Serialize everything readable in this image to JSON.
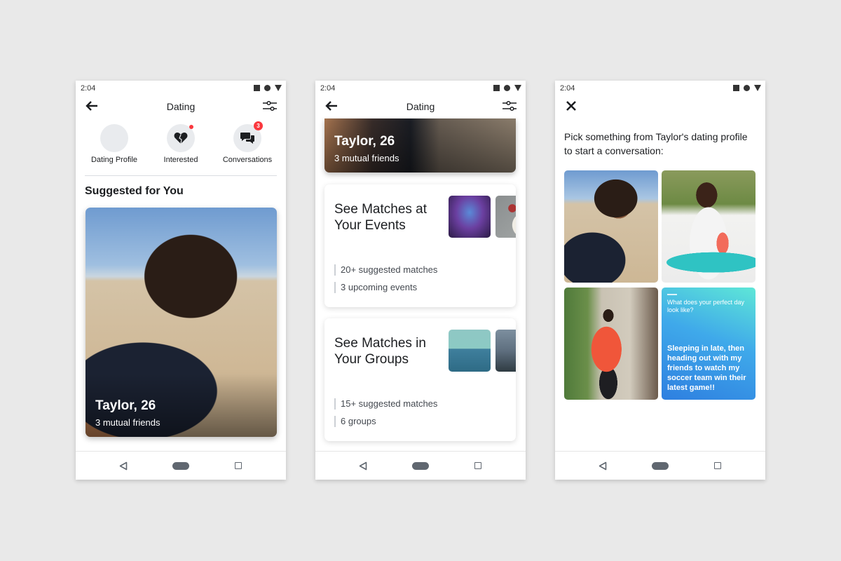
{
  "status_bar": {
    "time": "2:04"
  },
  "phone1": {
    "title": "Dating",
    "shortcuts": [
      {
        "label": "Dating Profile",
        "icon": "avatar"
      },
      {
        "label": "Interested",
        "icon": "heart-icon",
        "indicator": "dot"
      },
      {
        "label": "Conversations",
        "icon": "chat-bubbles-icon",
        "badge": "3"
      }
    ],
    "section_title": "Suggested for You",
    "profile": {
      "name": "Taylor, 26",
      "mutual": "3 mutual friends"
    }
  },
  "phone2": {
    "title": "Dating",
    "top_card": {
      "name": "Taylor, 26",
      "mutual": "3 mutual friends"
    },
    "cards": [
      {
        "title": "See Matches at Your Events",
        "stats": [
          "20+ suggested matches",
          "3 upcoming events"
        ]
      },
      {
        "title": "See Matches in Your Groups",
        "stats": [
          "15+ suggested matches",
          "6 groups"
        ]
      }
    ]
  },
  "phone3": {
    "prompt": "Pick something from Taylor's dating profile to start a conversation:",
    "question_card": {
      "question": "What does your perfect day look like?",
      "answer": "Sleeping in late, then heading out with my friends to watch my soccer team win their latest game!!"
    }
  },
  "colors": {
    "badge_red": "#fa383e",
    "prompt_gradient_start": "#5ee7d7",
    "prompt_gradient_end": "#2e7fe0"
  }
}
